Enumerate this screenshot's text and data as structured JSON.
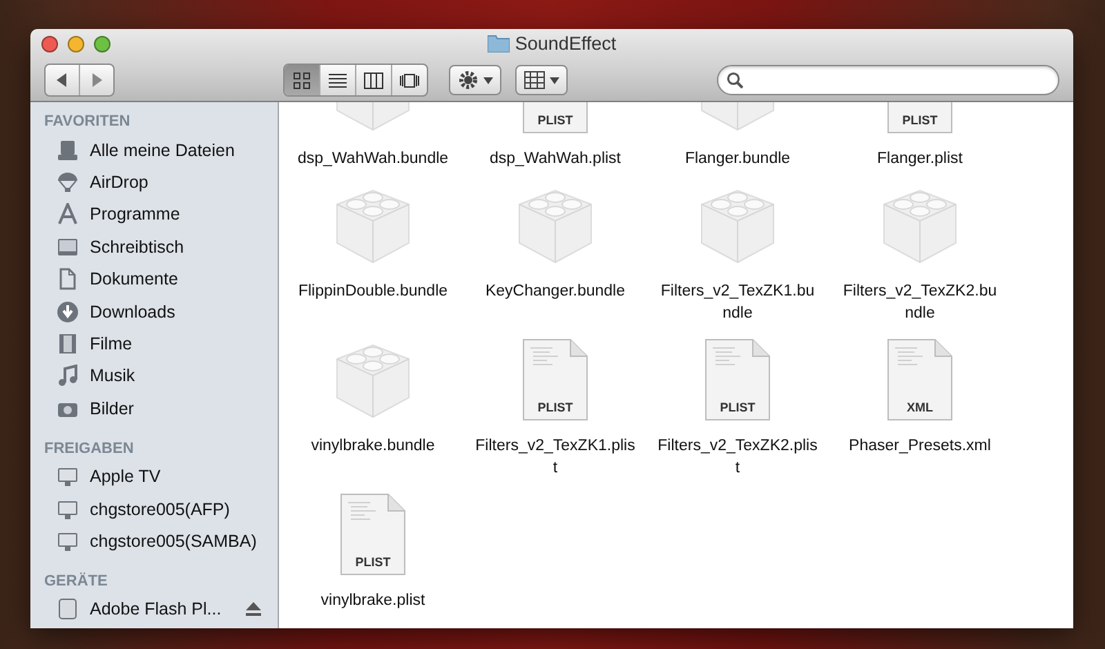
{
  "window": {
    "title": "SoundEffect"
  },
  "toolbar": {
    "views": [
      {
        "kind": "icons",
        "selected": true
      },
      {
        "kind": "list",
        "selected": false
      },
      {
        "kind": "columns",
        "selected": false
      },
      {
        "kind": "coverflow",
        "selected": false
      }
    ]
  },
  "sidebar": {
    "sections": [
      {
        "title": "FAVORITEN",
        "items": [
          {
            "label": "Alle meine Dateien",
            "kind": "all-files",
            "selected": false
          },
          {
            "label": "AirDrop",
            "kind": "airdrop",
            "selected": false
          },
          {
            "label": "Programme",
            "kind": "apps",
            "selected": false
          },
          {
            "label": "Schreibtisch",
            "kind": "desktop",
            "selected": false
          },
          {
            "label": "Dokumente",
            "kind": "documents",
            "selected": false
          },
          {
            "label": "Downloads",
            "kind": "downloads",
            "selected": false
          },
          {
            "label": "Filme",
            "kind": "movies",
            "selected": false
          },
          {
            "label": "Musik",
            "kind": "music",
            "selected": false
          },
          {
            "label": "Bilder",
            "kind": "pictures",
            "selected": false
          }
        ]
      },
      {
        "title": "FREIGABEN",
        "items": [
          {
            "label": "Apple TV",
            "kind": "computer",
            "selected": false
          },
          {
            "label": "chgstore005(AFP)",
            "kind": "computer",
            "selected": false
          },
          {
            "label": "chgstore005(SAMBA)",
            "kind": "computer",
            "selected": false
          }
        ]
      },
      {
        "title": "GERÄTE",
        "items": [
          {
            "label": "Adobe Flash Pl...",
            "kind": "disk",
            "selected": false
          }
        ]
      }
    ]
  },
  "files": [
    {
      "name": "dsp_WahWah.bundle",
      "kind": "bundle",
      "selected": false
    },
    {
      "name": "dsp_WahWah.plist",
      "kind": "document",
      "badge": "PLIST",
      "selected": false
    },
    {
      "name": "Flanger.bundle",
      "kind": "bundle",
      "selected": false
    },
    {
      "name": "Flanger.plist",
      "kind": "document",
      "badge": "PLIST",
      "selected": false
    },
    {
      "name": "FlippinDouble.bundle",
      "kind": "bundle",
      "selected": false
    },
    {
      "name": "KeyChanger.bundle",
      "kind": "bundle",
      "selected": false
    },
    {
      "name": "Filters_v2_TexZK1.bundle",
      "kind": "bundle",
      "selected": false
    },
    {
      "name": "Filters_v2_TexZK2.bundle",
      "kind": "bundle",
      "selected": false
    },
    {
      "name": "vinylbrake.bundle",
      "kind": "bundle",
      "selected": false
    },
    {
      "name": "Filters_v2_TexZK1.plist",
      "kind": "document",
      "badge": "PLIST",
      "selected": false
    },
    {
      "name": "Filters_v2_TexZK2.plist",
      "kind": "document",
      "badge": "PLIST",
      "selected": false
    },
    {
      "name": "Phaser_Presets.xml",
      "kind": "document",
      "badge": "XML",
      "selected": false
    },
    {
      "name": "vinylbrake.plist",
      "kind": "document",
      "badge": "PLIST",
      "selected": false
    }
  ]
}
